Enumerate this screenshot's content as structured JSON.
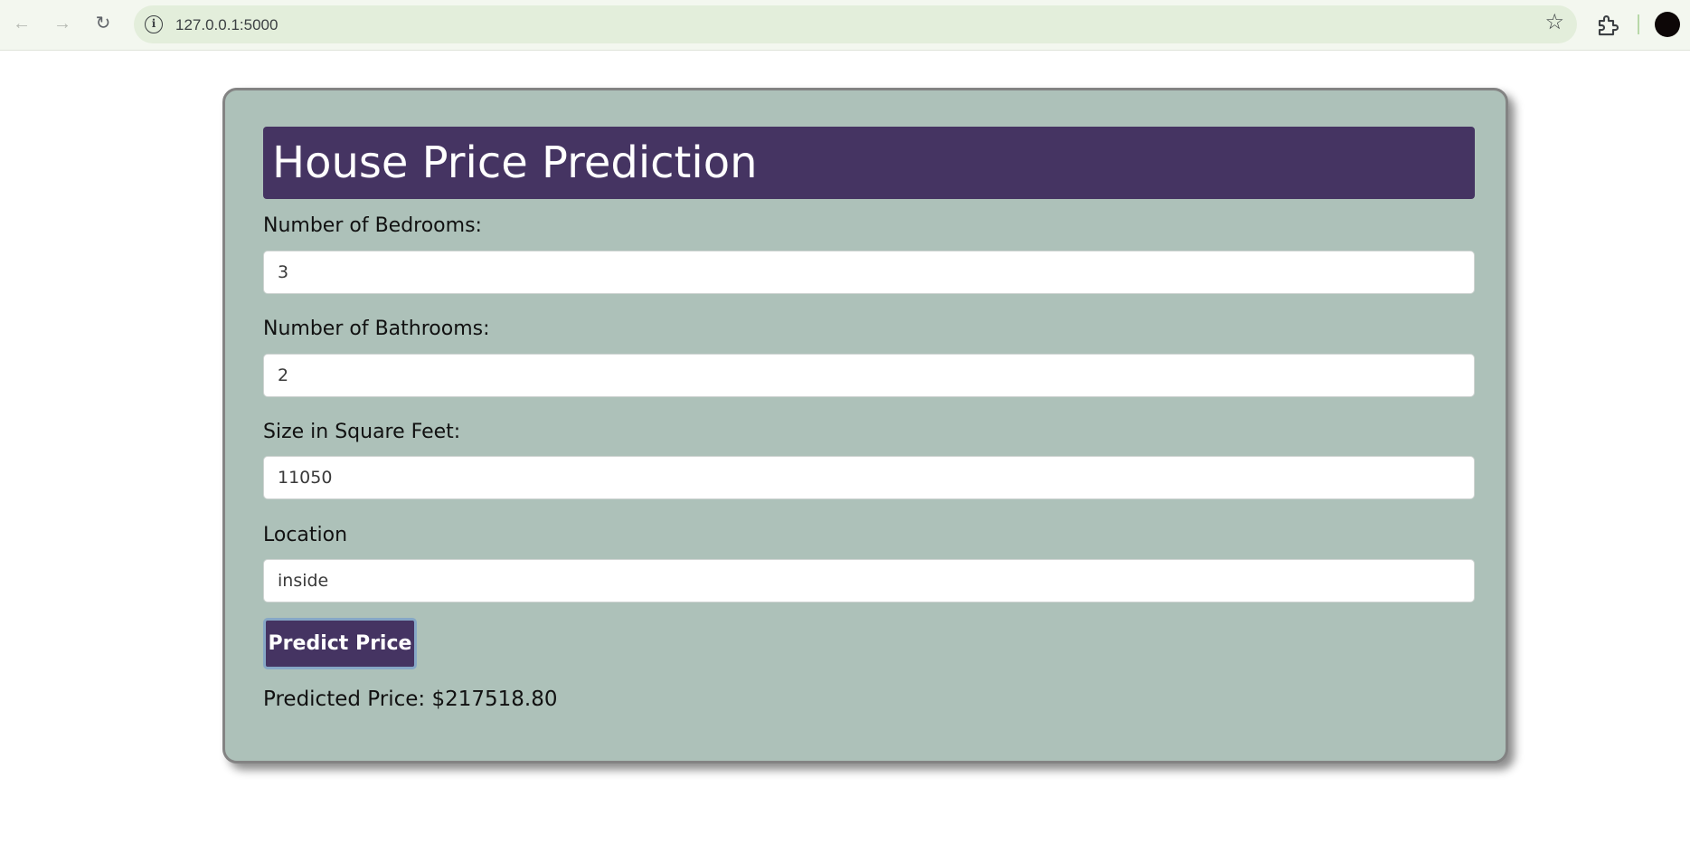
{
  "browser": {
    "url": "127.0.0.1:5000",
    "back_icon": "arrow-left-icon",
    "forward_icon": "arrow-right-icon",
    "reload_icon": "reload-icon",
    "info_icon": "info-icon",
    "bookmark_icon": "star-icon",
    "extensions_icon": "puzzle-icon"
  },
  "app": {
    "title": "House Price Prediction",
    "fields": [
      {
        "label": "Number of Bedrooms:",
        "value": "3"
      },
      {
        "label": "Number of Bathrooms:",
        "value": "2"
      },
      {
        "label": "Size in Square Feet:",
        "value": "11050"
      },
      {
        "label": "Location",
        "value": "inside"
      }
    ],
    "predict_label": "Predict Price",
    "result": "Predicted Price: $217518.80"
  },
  "colors": {
    "card_background": "#adc1b9",
    "accent": "#453462",
    "page_background": "#ffffff"
  }
}
